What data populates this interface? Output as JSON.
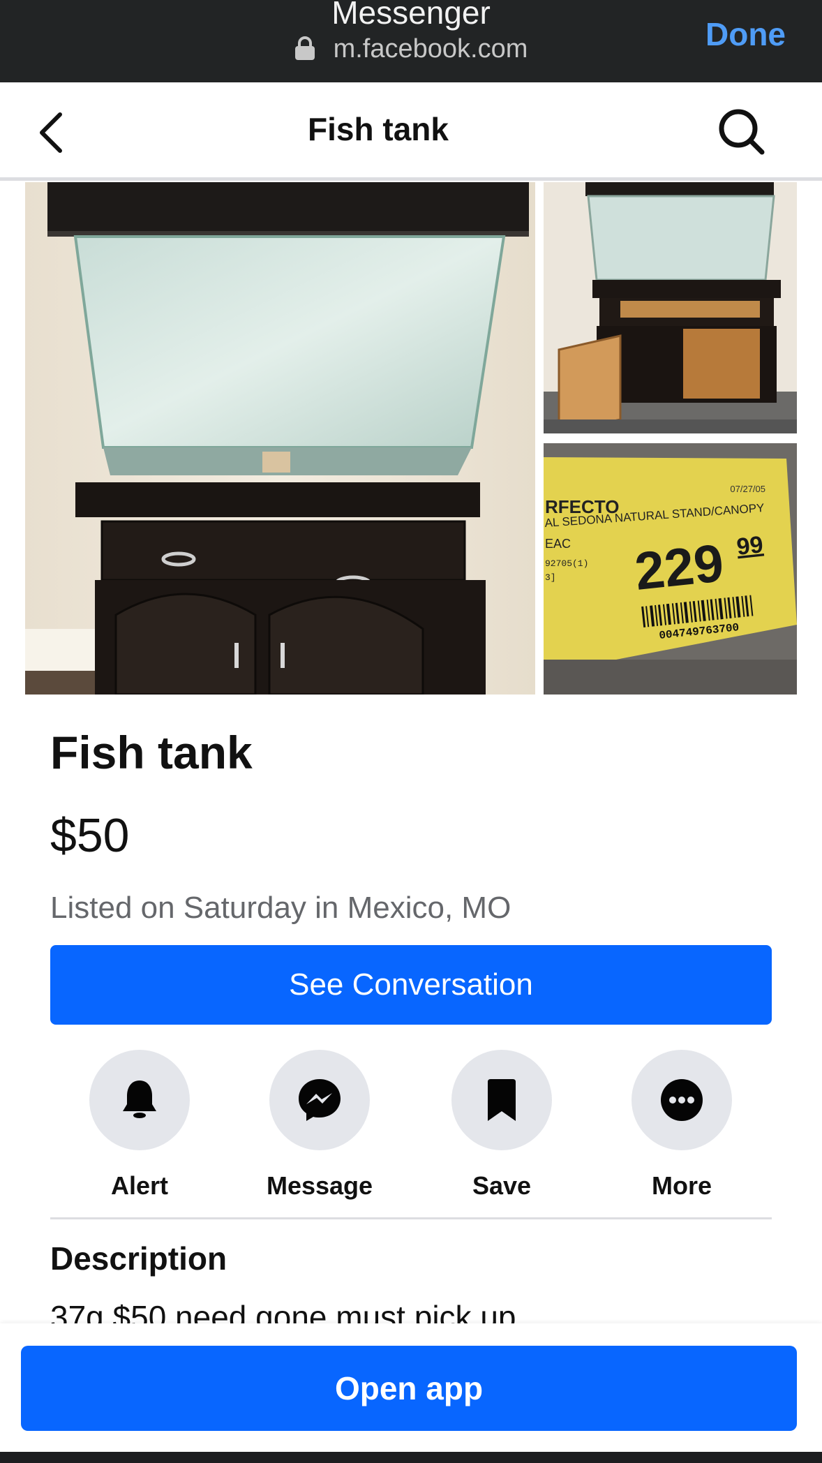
{
  "browser": {
    "title": "Messenger",
    "url": "m.facebook.com",
    "done_label": "Done",
    "link_color": "#4f9cf6"
  },
  "header": {
    "title": "Fish tank"
  },
  "photos": {
    "price_tag": {
      "date": "07/27/05",
      "line1": "RFECTO",
      "line2": "AL SEDONA NATURAL STAND/CANOPY",
      "line3": "EAC",
      "line4": "92705(1)",
      "line5": "3]",
      "price_main": "229",
      "price_cents": "99",
      "barcode_number": "004749763700"
    }
  },
  "listing": {
    "title": "Fish tank",
    "price": "$50",
    "meta": "Listed on Saturday in Mexico, MO",
    "primary_button": "See Conversation",
    "primary_color": "#0866ff"
  },
  "actions": [
    {
      "label": "Alert",
      "icon": "bell-icon"
    },
    {
      "label": "Message",
      "icon": "messenger-icon"
    },
    {
      "label": "Save",
      "icon": "bookmark-icon"
    },
    {
      "label": "More",
      "icon": "more-icon"
    }
  ],
  "description": {
    "heading": "Description",
    "text": "37g $50 need gone must pick up"
  },
  "bottom": {
    "open_app_label": "Open app"
  }
}
